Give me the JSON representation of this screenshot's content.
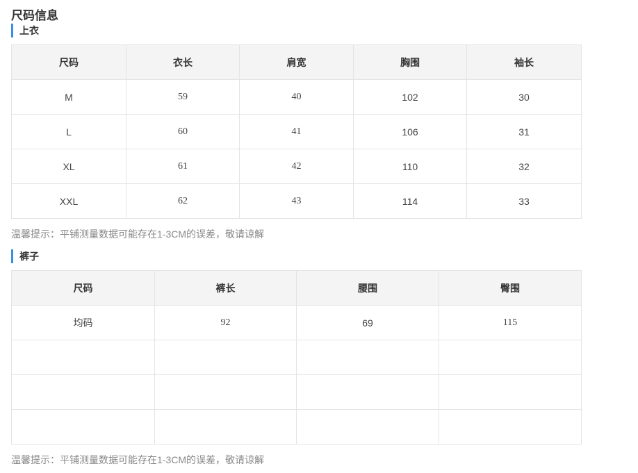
{
  "title": "尺码信息",
  "top": {
    "section_label": "上衣",
    "headers": [
      "尺码",
      "衣长",
      "肩宽",
      "胸围",
      "袖长"
    ],
    "rows": [
      [
        "M",
        "59",
        "40",
        "102",
        "30"
      ],
      [
        "L",
        "60",
        "41",
        "106",
        "31"
      ],
      [
        "XL",
        "61",
        "42",
        "110",
        "32"
      ],
      [
        "XXL",
        "62",
        "43",
        "114",
        "33"
      ]
    ],
    "note": "温馨提示：平铺测量数据可能存在1-3CM的误差，敬请谅解"
  },
  "pants": {
    "section_label": "裤子",
    "headers": [
      "尺码",
      "裤长",
      "腰围",
      "臀围"
    ],
    "rows": [
      [
        "均码",
        "92",
        "69",
        "115"
      ],
      [
        "",
        "",
        "",
        ""
      ],
      [
        "",
        "",
        "",
        ""
      ],
      [
        "",
        "",
        "",
        ""
      ]
    ],
    "note": "温馨提示：平铺测量数据可能存在1-3CM的误差，敬请谅解"
  }
}
